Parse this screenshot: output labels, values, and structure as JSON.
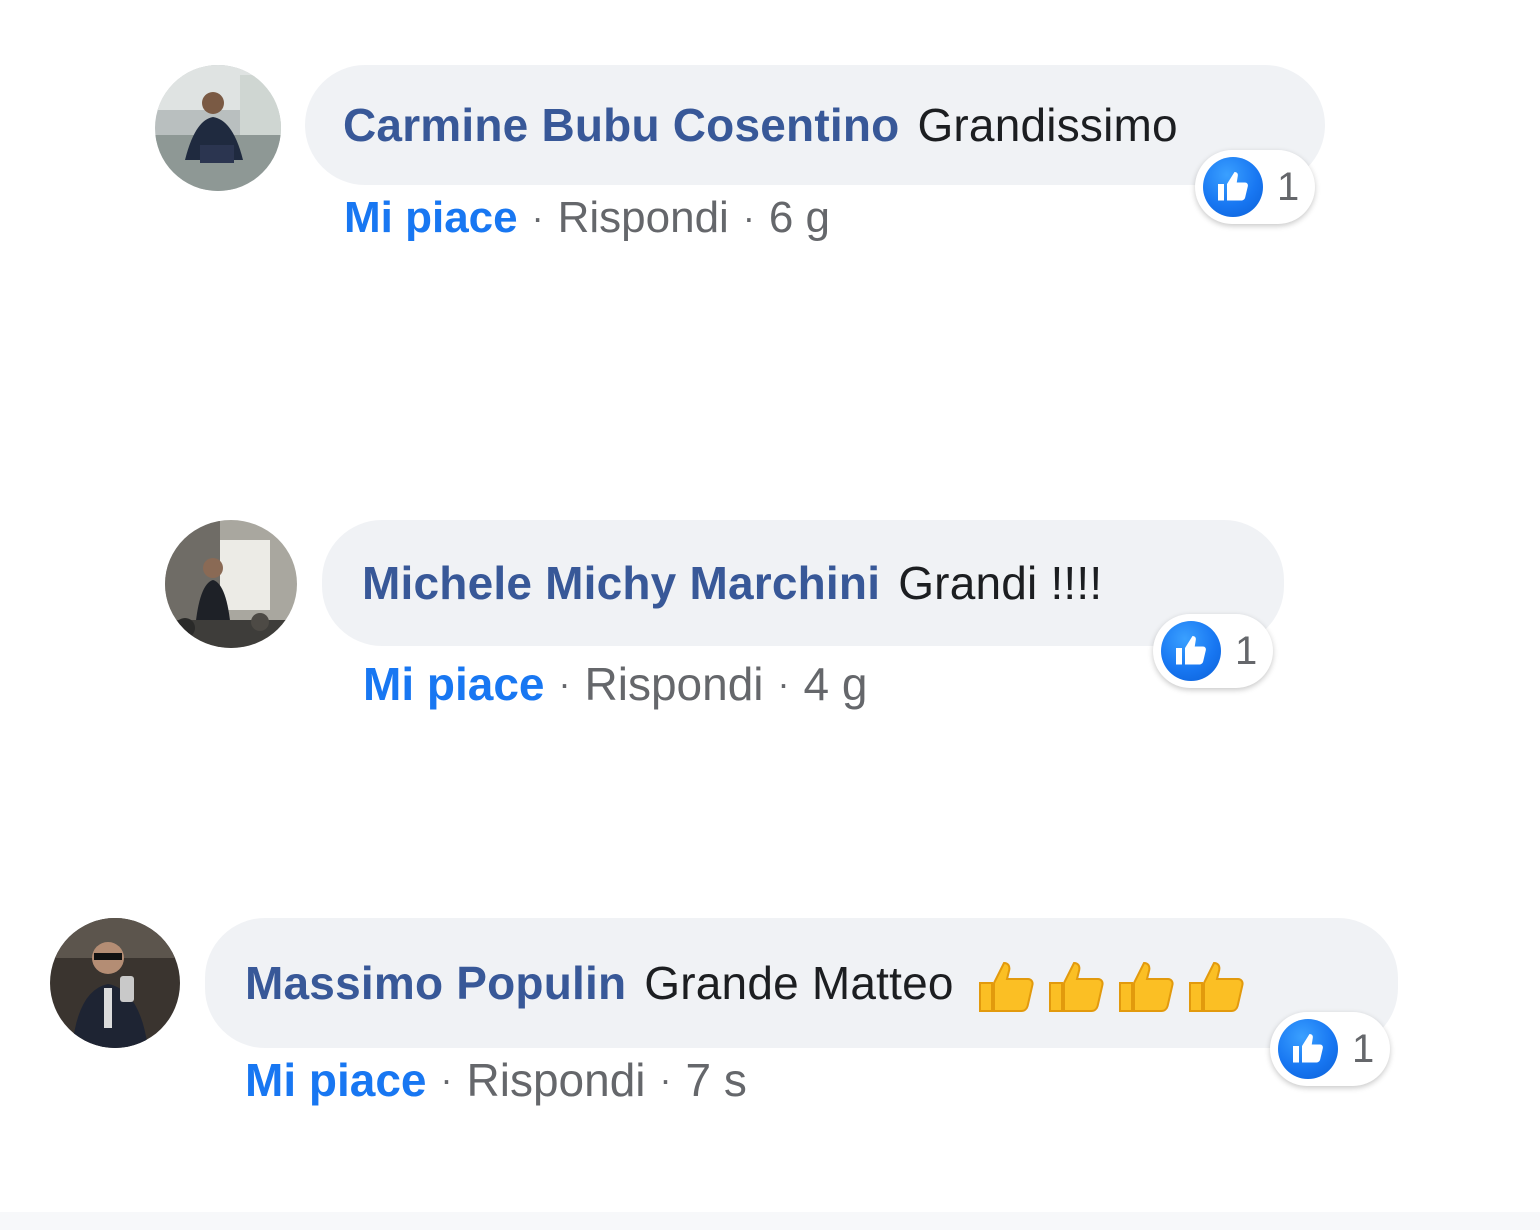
{
  "comments": [
    {
      "author": "Carmine Bubu Cosentino",
      "text": "Grandissimo",
      "reaction_count": "1",
      "like_label": "Mi piace",
      "reply_label": "Rispondi",
      "time": "6 g",
      "separator": "·"
    },
    {
      "author": "Michele Michy Marchini",
      "text": "Grandi !!!!",
      "reaction_count": "1",
      "like_label": "Mi piace",
      "reply_label": "Rispondi",
      "time": "4 g",
      "separator": "·"
    },
    {
      "author": "Massimo Populin",
      "text": "Grande Matteo",
      "emojis": [
        "thumbs-up-emoji",
        "thumbs-up-emoji",
        "thumbs-up-emoji",
        "thumbs-up-emoji"
      ],
      "reaction_count": "1",
      "like_label": "Mi piace",
      "reply_label": "Rispondi",
      "time": "7 s",
      "separator": "·"
    }
  ],
  "colors": {
    "author": "#385898",
    "like_link": "#1877f2",
    "muted": "#65676b",
    "bubble": "#f0f2f5",
    "like_badge": "#1877f2"
  },
  "icons": {
    "reaction": "like-thumb-icon",
    "emoji": "thumbs-up-emoji"
  }
}
